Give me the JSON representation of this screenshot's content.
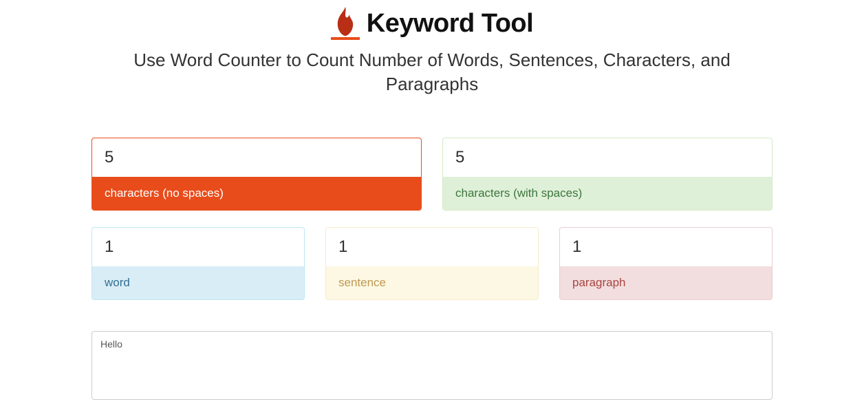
{
  "header": {
    "title": "Keyword Tool",
    "subtitle": "Use Word Counter to Count Number of Words, Sentences, Characters, and Paragraphs"
  },
  "stats": {
    "chars_no_spaces": {
      "value": "5",
      "label": "characters (no spaces)"
    },
    "chars_with_spaces": {
      "value": "5",
      "label": "characters (with spaces)"
    },
    "words": {
      "value": "1",
      "label": "word"
    },
    "sentences": {
      "value": "1",
      "label": "sentence"
    },
    "paragraphs": {
      "value": "1",
      "label": "paragraph"
    }
  },
  "input": {
    "text": "Hello"
  }
}
